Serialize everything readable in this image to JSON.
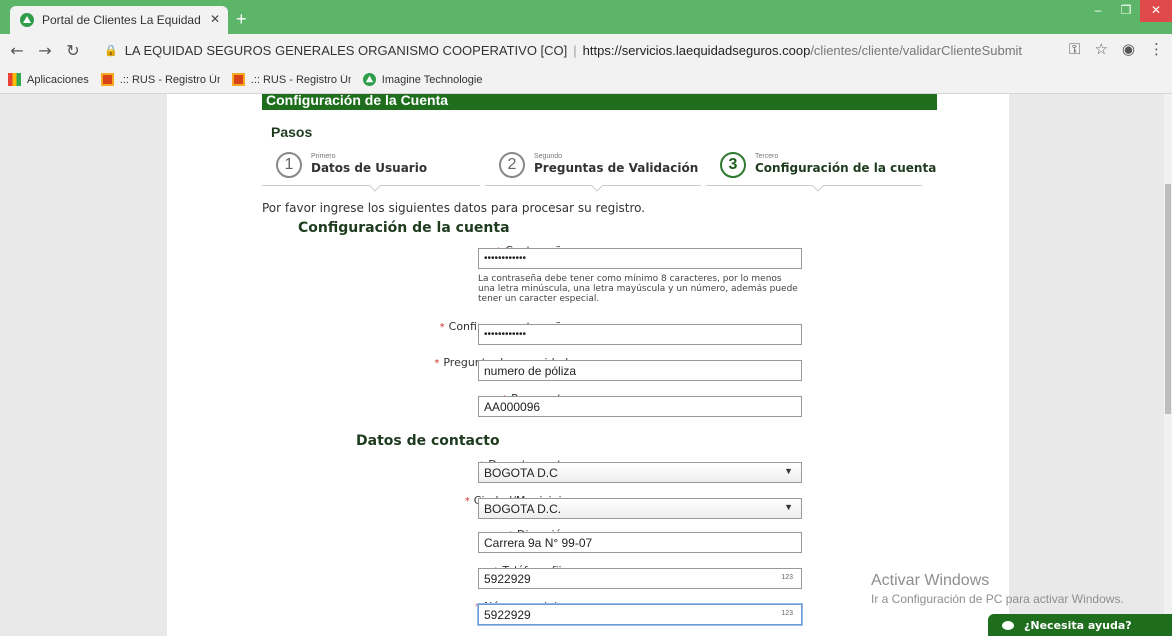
{
  "browser": {
    "tab_title": "Portal de Clientes La Equidad Seguros",
    "new_tab": "+",
    "address": {
      "site_name": "LA EQUIDAD SEGUROS GENERALES ORGANISMO COOPERATIVO [CO]",
      "separator": "|",
      "host": "https://servicios.laequidadseguros.coop",
      "path": "/clientes/cliente/validarClienteSubmit"
    },
    "bookmarks": [
      {
        "label": "Aplicaciones",
        "icon": "apps-grid-icon"
      },
      {
        "label": ".:: RUS - Registro Único",
        "icon": "rus-icon"
      },
      {
        "label": ".:: RUS - Registro Único",
        "icon": "rus-icon"
      },
      {
        "label": "Imagine Technologie",
        "icon": "equidad-icon"
      }
    ]
  },
  "header": {
    "bar_title": "Configuración de la Cuenta",
    "pasos": "Pasos"
  },
  "steps": [
    {
      "num": "1",
      "small": "Primero",
      "label": "Datos de Usuario",
      "active": false
    },
    {
      "num": "2",
      "small": "Segundo",
      "label": "Preguntas de Validación",
      "active": false
    },
    {
      "num": "3",
      "small": "Tercero",
      "label": "Configuración de la cuenta",
      "active": true
    }
  ],
  "intro": "Por favor ingrese los siguientes datos para procesar su registro.",
  "account_section": {
    "title": "Configuración de la cuenta",
    "password_label": "Contraseña:",
    "password_value": "••••••••••••",
    "password_help": "La contraseña debe tener como mínimo 8 caracteres, por lo menos una letra minúscula, una letra mayúscula y un número, además puede tener un caracter especial.",
    "confirm_label": "Confirmar contraseña:",
    "confirm_value": "••••••••••••",
    "question_label": "Pregunta de seguridad:",
    "question_value": "numero de póliza",
    "answer_label": "Respuesta:",
    "answer_value": "AA000096"
  },
  "contact_section": {
    "title": "Datos de contacto",
    "departamento_label": "Departamento:",
    "departamento_value": "BOGOTA D.C",
    "ciudad_label": "Ciudad/Municipio:",
    "ciudad_value": "BOGOTA D.C.",
    "direccion_label": "Dirección:",
    "direccion_value": "Carrera 9a N° 99-07",
    "telefono_label": "Teléfono fijo:",
    "telefono_value": "5922929",
    "celular_label": "Número celular:",
    "celular_value": "5922929",
    "numeric_hint": "123",
    "required_mark": "*"
  },
  "overlay": {
    "activate_title": "Activar Windows",
    "activate_sub": "Ir a Configuración de PC para activar Windows.",
    "chat_label": "¿Necesita ayuda?"
  },
  "colors": {
    "brand_green": "#1e6e1e",
    "chrome_green": "#5db56a"
  }
}
